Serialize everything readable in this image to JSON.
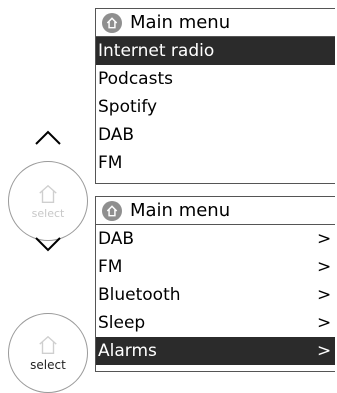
{
  "screen_top": {
    "title": "Main menu",
    "items": [
      {
        "label": "Internet radio",
        "selected": true,
        "chevron": ""
      },
      {
        "label": "Podcasts",
        "selected": false,
        "chevron": ""
      },
      {
        "label": "Spotify",
        "selected": false,
        "chevron": ""
      },
      {
        "label": "DAB",
        "selected": false,
        "chevron": ""
      },
      {
        "label": "FM",
        "selected": false,
        "chevron": ""
      }
    ]
  },
  "screen_bottom": {
    "title": "Main menu",
    "items": [
      {
        "label": "DAB",
        "selected": false,
        "chevron": ">"
      },
      {
        "label": "FM",
        "selected": false,
        "chevron": ">"
      },
      {
        "label": "Bluetooth",
        "selected": false,
        "chevron": ">"
      },
      {
        "label": "Sleep",
        "selected": false,
        "chevron": ">"
      },
      {
        "label": "Alarms",
        "selected": true,
        "chevron": ">"
      }
    ]
  },
  "knob_top": {
    "label": "select",
    "icon": "home-icon"
  },
  "knob_bottom": {
    "label": "select",
    "icon": "home-icon"
  },
  "colors": {
    "selected_bg": "#2b2b2b",
    "home_badge": "#8f8f8f"
  }
}
